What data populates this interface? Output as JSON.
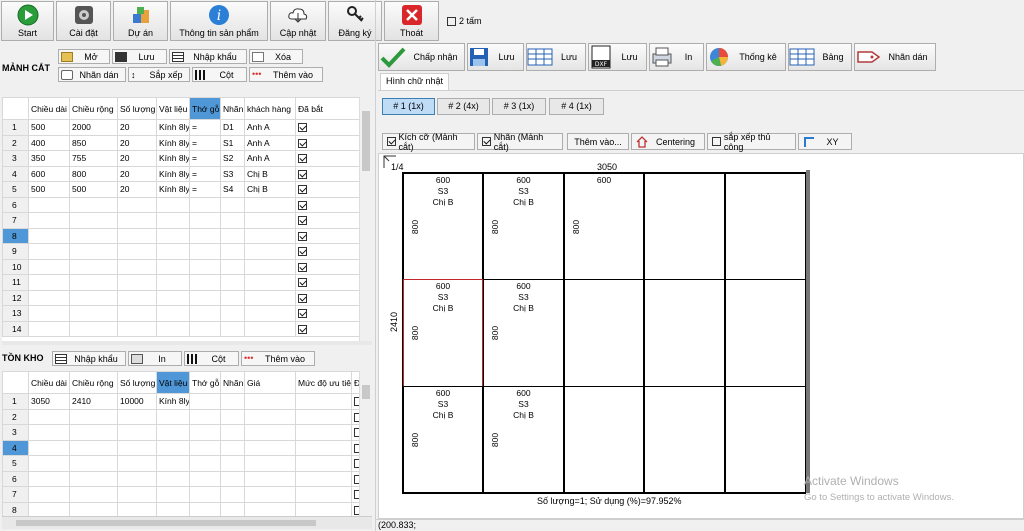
{
  "toolbar": {
    "start": "Start",
    "settings": "Cài đặt",
    "project": "Dự án",
    "product_info": "Thông tin sản phẩm",
    "update": "Cập nhật",
    "register": "Đăng ký",
    "exit": "Thoát",
    "two_sheets": "2 tấm"
  },
  "manh_cat": {
    "title": "MẢNH CẮT",
    "open": "Mở",
    "save": "Lưu",
    "import": "Nhập khẩu",
    "delete": "Xóa",
    "label": "Nhãn dán",
    "sort": "Sắp xếp",
    "column": "Cột",
    "add": "Thêm vào",
    "headers": [
      "Chiều dài",
      "Chiều rộng",
      "Số lượng",
      "Vật liệu",
      "Thớ gỗ",
      "Nhãn",
      "khách hàng",
      "Đã bắt"
    ],
    "rows": [
      [
        "500",
        "2000",
        "20",
        "Kính 8ly",
        "=",
        "D1",
        "Anh A"
      ],
      [
        "400",
        "850",
        "20",
        "Kính 8ly",
        "=",
        "S1",
        "Anh A"
      ],
      [
        "350",
        "755",
        "20",
        "Kính 8ly",
        "=",
        "S2",
        "Anh A"
      ],
      [
        "600",
        "800",
        "20",
        "Kính 8ly",
        "=",
        "S3",
        "Chị B"
      ],
      [
        "500",
        "500",
        "20",
        "Kính 8ly",
        "=",
        "S4",
        "Chị B"
      ]
    ],
    "row_numbers": [
      "1",
      "2",
      "3",
      "4",
      "5",
      "6",
      "7",
      "8",
      "9",
      "10",
      "11",
      "12",
      "13",
      "14"
    ]
  },
  "ton_kho": {
    "title": "TỒN KHO",
    "import": "Nhập khẩu",
    "print": "In",
    "column": "Cột",
    "add": "Thêm vào",
    "headers": [
      "Chiều dài",
      "Chiều rộng",
      "Số lượng",
      "Vật liệu",
      "Thớ gỗ",
      "Nhãn",
      "Giá",
      "Mức độ ưu tiên",
      "Đ"
    ],
    "rows": [
      [
        "3050",
        "2410",
        "10000",
        "Kính 8ly",
        "",
        "",
        "",
        ""
      ]
    ],
    "row_numbers": [
      "1",
      "2",
      "3",
      "4",
      "5",
      "6",
      "7",
      "8"
    ]
  },
  "right": {
    "accept": "Chấp nhận",
    "save1": "Lưu",
    "save2": "Lưu",
    "save3": "Lưu",
    "print": "In",
    "stats": "Thống kê",
    "table": "Bảng",
    "label": "Nhãn dán",
    "dxf": "DXF",
    "tab": "Hình chữ nhật",
    "patterns": [
      "# 1 (1x)",
      "# 2 (4x)",
      "# 3 (1x)",
      "# 4 (1x)"
    ],
    "opt_size": "Kích cỡ (Mảnh cắt)",
    "opt_label": "Nhãn (Mảnh cắt)",
    "opt_add": "Thêm vào...",
    "opt_center": "Centering",
    "opt_manual": "sắp xếp thủ công",
    "opt_xy": "XY"
  },
  "layout": {
    "fraction": "1/4",
    "sheet_w": "3050",
    "sheet_h": "2410",
    "piece_w": "600",
    "piece_h": "800",
    "piece_label": "S3",
    "piece_cust": "Chị B",
    "summary": "Số lượng=1; Sử dụng (%)=97.952%",
    "status": "(200.833;",
    "watermark1": "Activate Windows",
    "watermark2": "Go to Settings to activate Windows."
  },
  "colors": {
    "accent": "#4f97d6",
    "exit_red": "#d9262a"
  }
}
